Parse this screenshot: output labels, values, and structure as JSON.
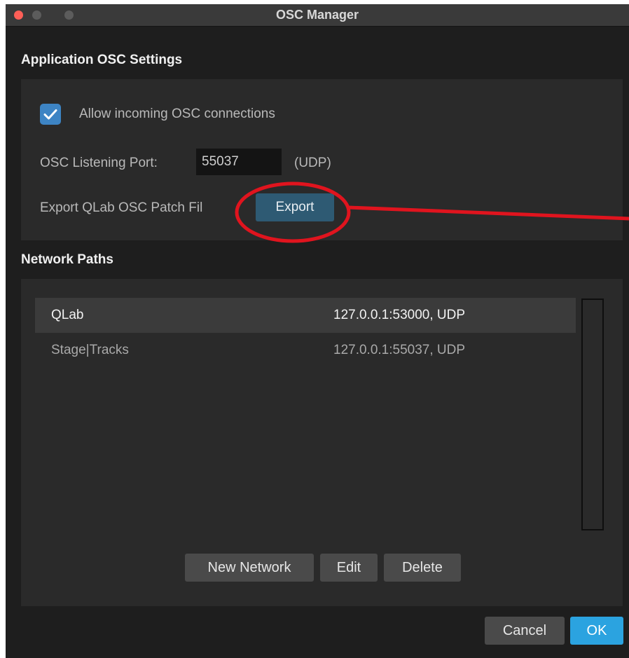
{
  "window": {
    "title": "OSC Manager"
  },
  "app_settings": {
    "section_title": "Application OSC Settings",
    "allow_incoming": {
      "label": "Allow incoming OSC connections",
      "checked": true
    },
    "port": {
      "label": "OSC Listening Port:",
      "value": "55037",
      "suffix": "(UDP)"
    },
    "export": {
      "label": "Export QLab OSC Patch File",
      "visible_label": "Export QLab OSC Patch Fil",
      "button": "Export"
    }
  },
  "network_paths": {
    "section_title": "Network Paths",
    "rows": [
      {
        "name": "QLab",
        "address": "127.0.0.1:53000, UDP",
        "selected": true
      },
      {
        "name": "Stage|Tracks",
        "address": "127.0.0.1:55037, UDP",
        "selected": false
      }
    ],
    "buttons": {
      "new": "New Network",
      "edit": "Edit",
      "delete": "Delete"
    }
  },
  "footer": {
    "cancel": "Cancel",
    "ok": "OK"
  },
  "colors": {
    "accent": "#2ba3e0",
    "checkbox": "#3d84c4",
    "export_button": "#2e5a73",
    "annotation": "#e0141e"
  },
  "icons": {
    "checkbox_mark": "checkmark-icon"
  }
}
